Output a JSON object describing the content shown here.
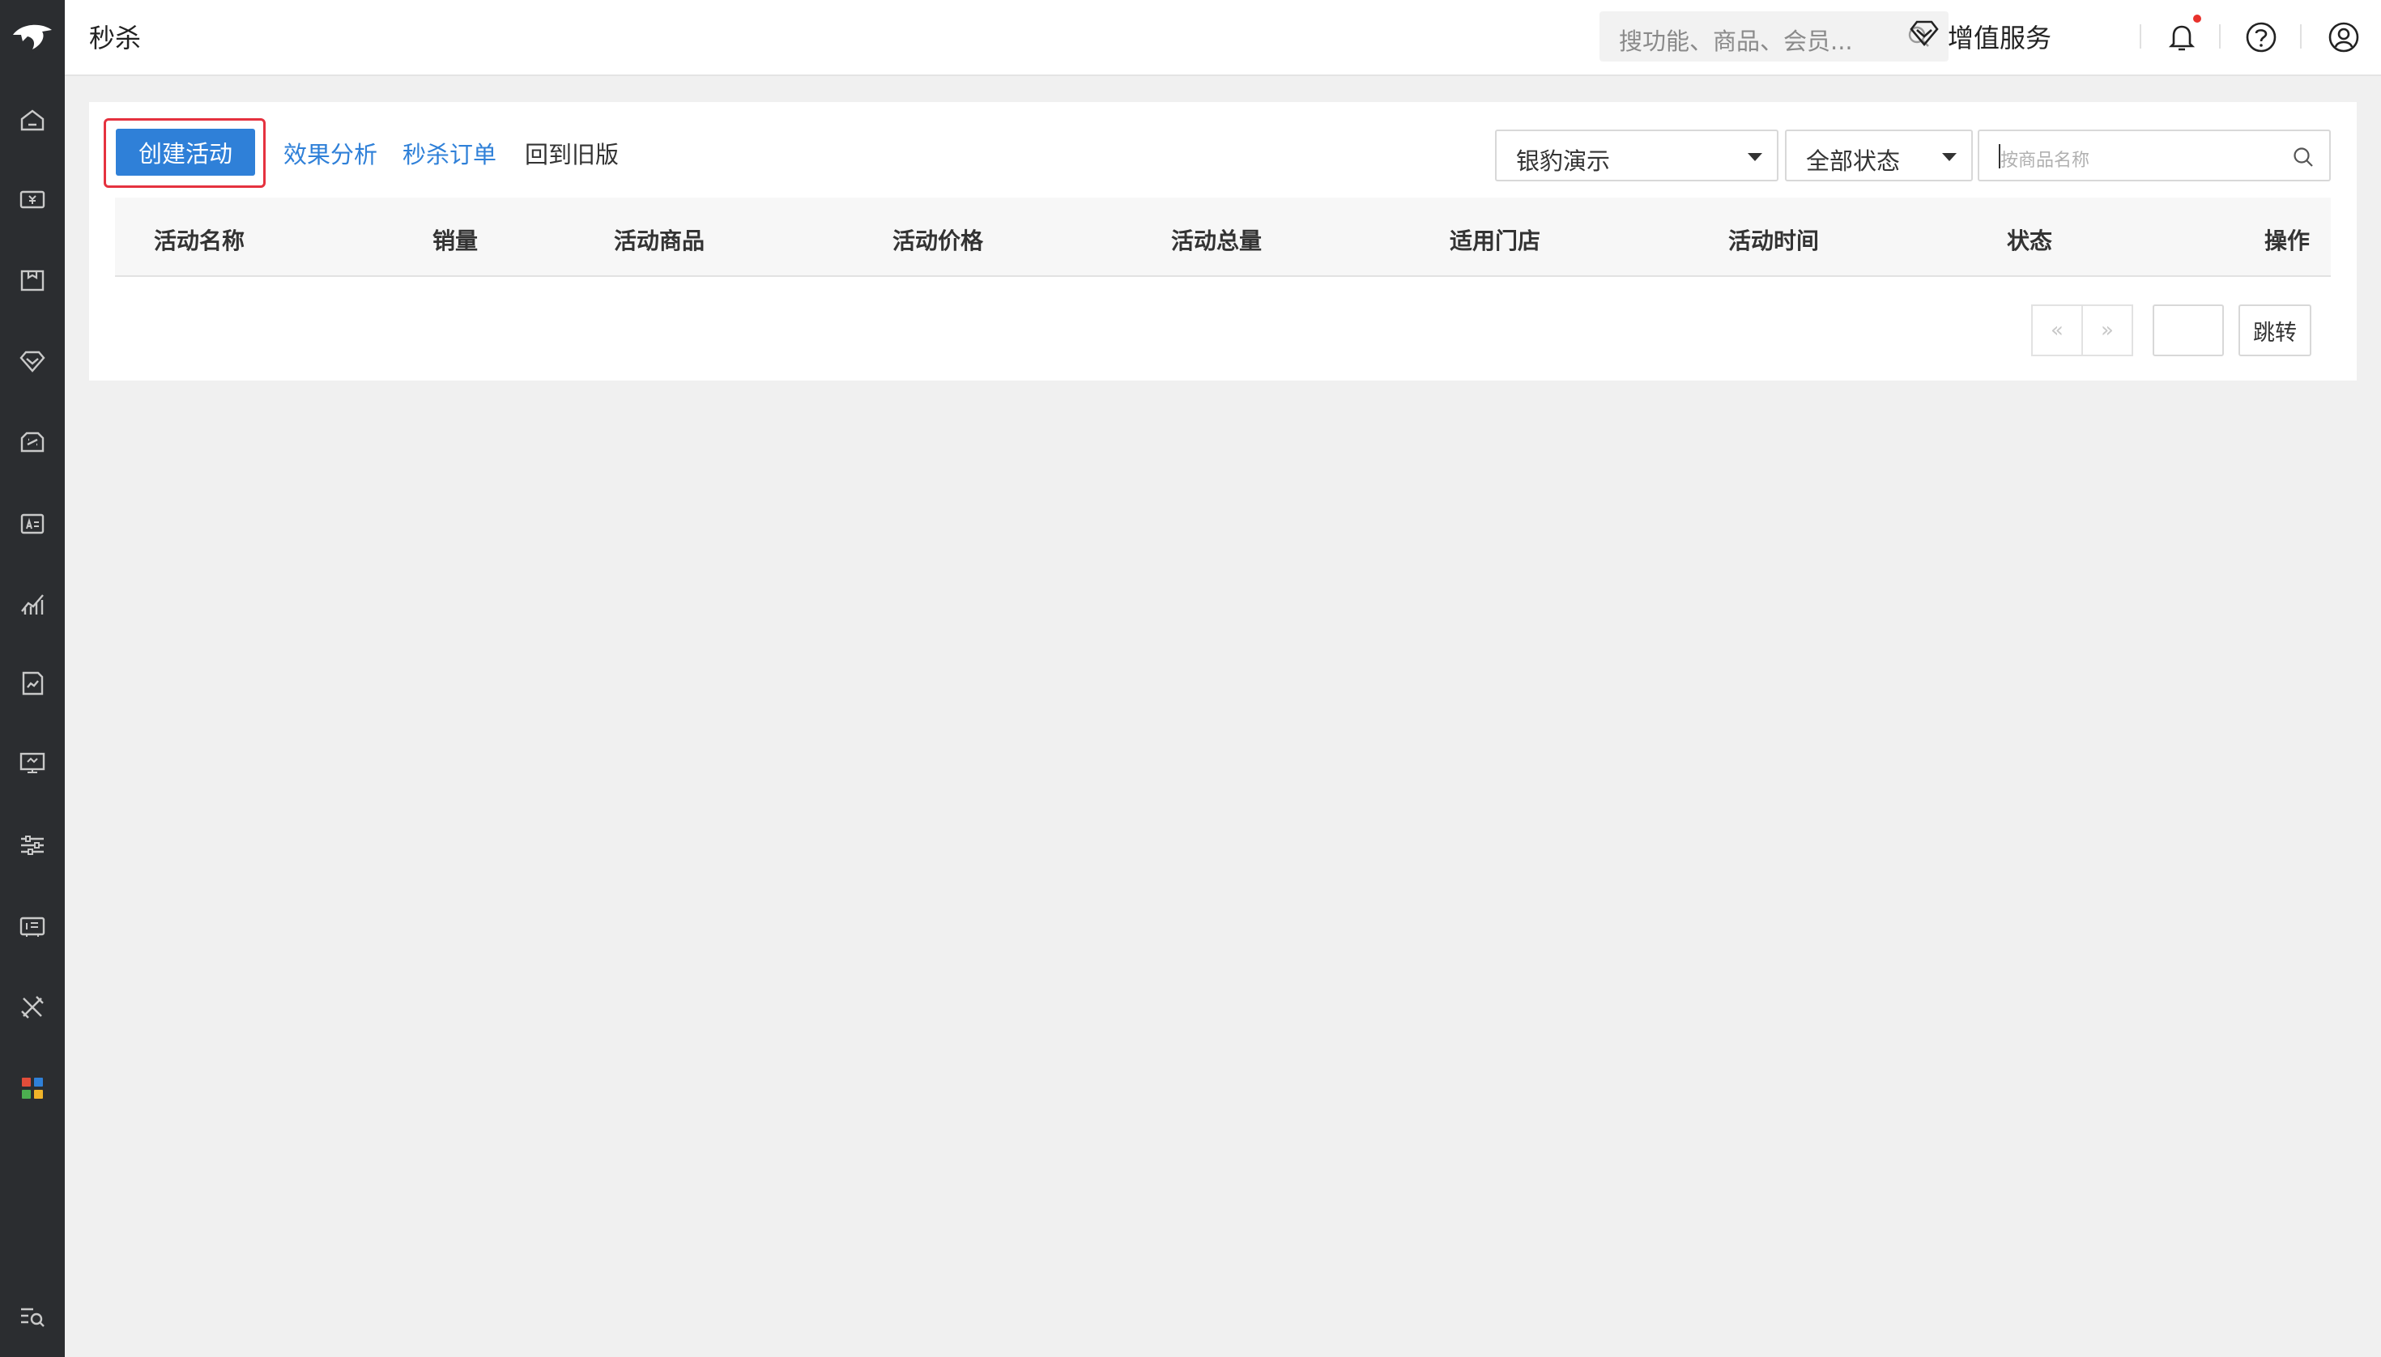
{
  "header": {
    "page_title": "秒杀",
    "search_placeholder": "搜功能、商品、会员...",
    "vip_label": "增值服务"
  },
  "sidebar": {
    "icons": [
      "home-icon",
      "cashier-icon",
      "goods-icon",
      "member-icon",
      "marketing-icon",
      "staff-icon",
      "analytics-icon",
      "report-icon",
      "screen-icon",
      "settings-icon",
      "wallet-icon",
      "tools-icon",
      "apps-icon",
      "search-menu-icon"
    ]
  },
  "toolbar": {
    "create_label": "创建活动",
    "links": [
      "效果分析",
      "秒杀订单",
      "回到旧版"
    ],
    "store_select": "银豹演示",
    "status_select": "全部状态",
    "search_placeholder": "按商品名称"
  },
  "table": {
    "columns": [
      "活动名称",
      "销量",
      "活动商品",
      "活动价格",
      "活动总量",
      "适用门店",
      "活动时间",
      "状态",
      "操作"
    ],
    "rows": []
  },
  "pagination": {
    "prev": "«",
    "next": "»",
    "page_value": "",
    "jump_label": "跳转"
  },
  "colors": {
    "sidebar_bg": "#2b2d30",
    "primary": "#2f80d8",
    "highlight": "#e5323f",
    "notification_dot": "#e8312c"
  }
}
